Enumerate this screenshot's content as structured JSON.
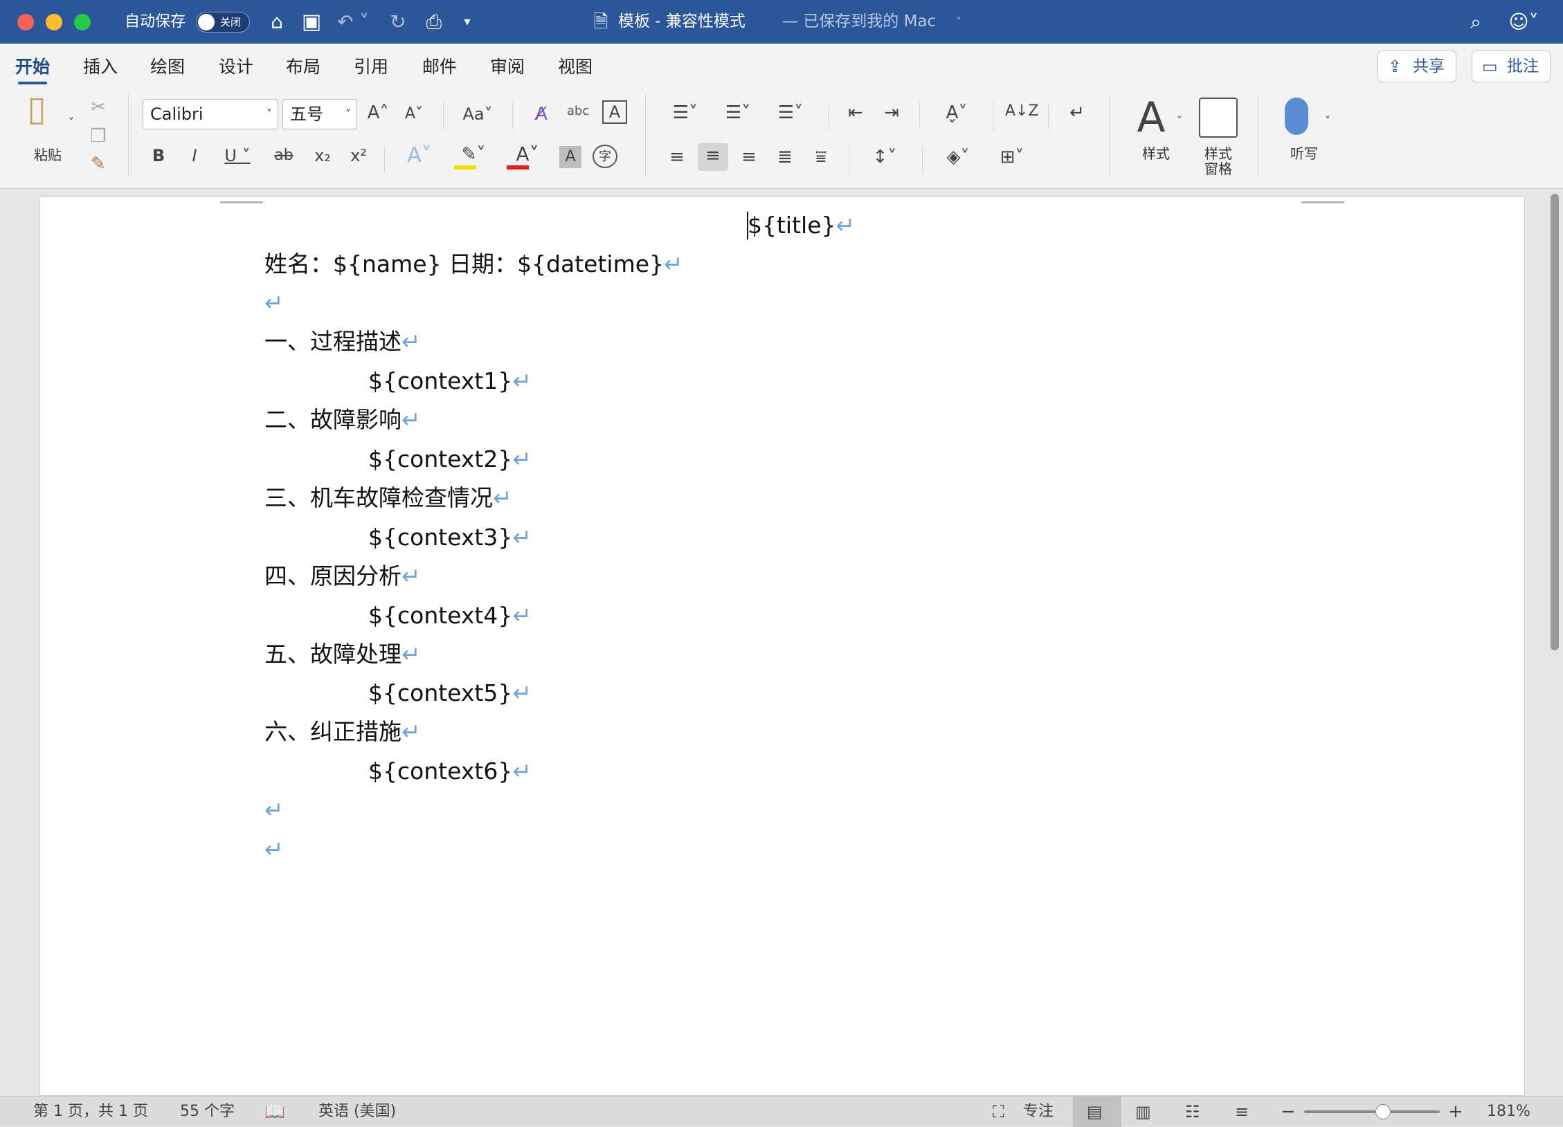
{
  "titlebar": {
    "autosave_label": "自动保存",
    "autosave_state": "关闭",
    "doc_name": "模板 - 兼容性模式",
    "save_status": "— 已保存到我的 Mac"
  },
  "tabs": [
    {
      "label": "开始"
    },
    {
      "label": "插入"
    },
    {
      "label": "绘图"
    },
    {
      "label": "设计"
    },
    {
      "label": "布局"
    },
    {
      "label": "引用"
    },
    {
      "label": "邮件"
    },
    {
      "label": "审阅"
    },
    {
      "label": "视图"
    }
  ],
  "header_buttons": {
    "share": "共享",
    "comment": "批注"
  },
  "ribbon": {
    "paste_label": "粘贴",
    "font_name": "Calibri",
    "font_size": "五号",
    "styles_label": "样式",
    "styles_pane_label": "样式\n窗格",
    "dictate_label": "听写"
  },
  "document": {
    "title": "${title}",
    "info_line": "姓名：${name}   日期：${datetime}",
    "sections": [
      {
        "heading": "一、过程描述",
        "content": "${context1}"
      },
      {
        "heading": "二、故障影响",
        "content": "${context2}"
      },
      {
        "heading": "三、机车故障检查情况",
        "content": "${context3}"
      },
      {
        "heading": "四、原因分析",
        "content": "${context4}"
      },
      {
        "heading": "五、故障处理",
        "content": "${context5}"
      },
      {
        "heading": "六、纠正措施",
        "content": "${context6}"
      }
    ],
    "paragraph_mark": "↵"
  },
  "statusbar": {
    "page_info": "第 1 页，共 1 页",
    "word_count": "55 个字",
    "language": "英语 (美国)",
    "focus_label": "专注",
    "zoom_value": "181%",
    "zoom_minus": "−",
    "zoom_plus": "+"
  },
  "colors": {
    "titlebar": "#2b579a",
    "paragraph_mark": "#6ea3dc",
    "highlight": "#f5e100",
    "font_color": "#e02020"
  }
}
